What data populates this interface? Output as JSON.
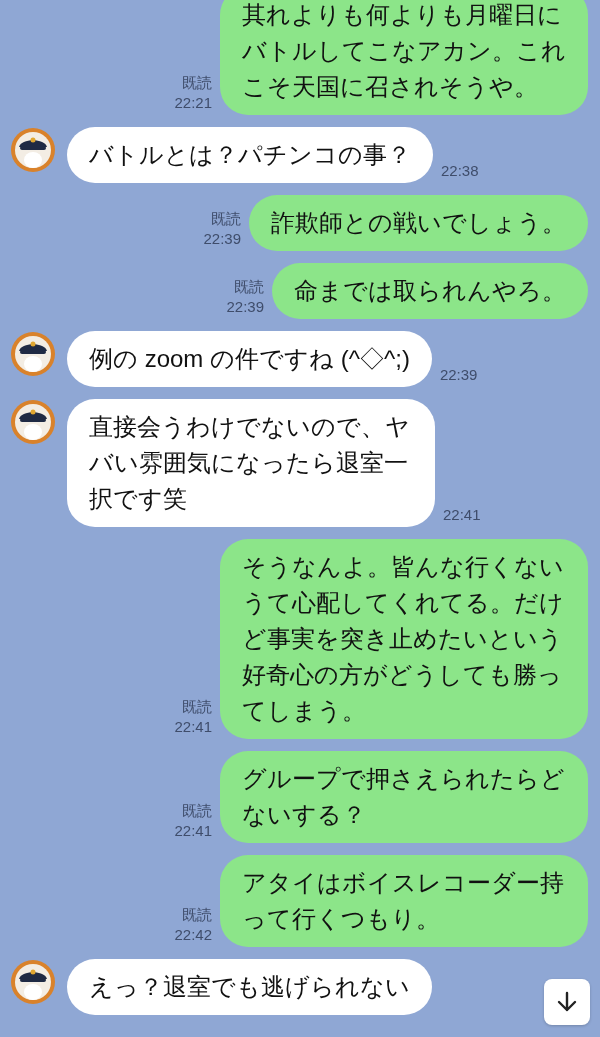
{
  "messages": [
    {
      "kind": "outgoing",
      "text": "其れよりも何よりも月曜日にバトルしてこなアカン。これこそ天国に召されそうや。",
      "read_label": "既読",
      "time": "22:21"
    },
    {
      "kind": "incoming",
      "text": "バトルとは？パチンコの事？",
      "time": "22:38"
    },
    {
      "kind": "outgoing",
      "text": "詐欺師との戦いでしょう。",
      "read_label": "既読",
      "time": "22:39"
    },
    {
      "kind": "outgoing",
      "text": "命までは取られんやろ。",
      "read_label": "既読",
      "time": "22:39"
    },
    {
      "kind": "incoming",
      "text": "例の zoom の件ですね (^◇^;)",
      "time": "22:39"
    },
    {
      "kind": "incoming",
      "text": "直接会うわけでないので、ヤバい雰囲気になったら退室一択です笑",
      "time": "22:41"
    },
    {
      "kind": "outgoing",
      "text": "そうなんよ。皆んな行くないうて心配してくれてる。だけど事実を突き止めたいという好奇心の方がどうしても勝ってしまう。",
      "read_label": "既読",
      "time": "22:41"
    },
    {
      "kind": "outgoing",
      "text": "グループで押さえられたらどないする？",
      "read_label": "既読",
      "time": "22:41"
    },
    {
      "kind": "outgoing",
      "text": "アタイはボイスレコーダー持って行くつもり。",
      "read_label": "既読",
      "time": "22:42"
    },
    {
      "kind": "incoming",
      "text": "えっ？退室でも逃げられない"
    }
  ]
}
